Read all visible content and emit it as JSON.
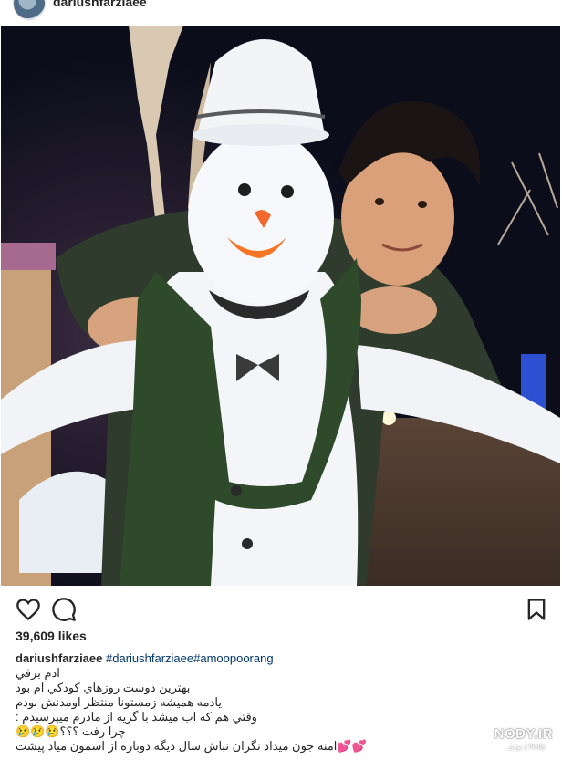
{
  "header": {
    "username": "dariushfarziaee",
    "avatar": "profile-avatar"
  },
  "post": {
    "image": "snowman-with-man-photo"
  },
  "actions": {
    "like_icon": "heart-icon",
    "comment_icon": "comment-bubble-icon",
    "save_icon": "bookmark-icon"
  },
  "likes": "39,609 likes",
  "caption": {
    "username": "dariushfarziaee",
    "hashtags": "#dariushfarziaee#amoopoorang",
    "lines": [
      "ادم برفي",
      "بهترين دوست روزهاي كودكي ام بود",
      "يادمه هميشه زمستونا منتظر اومدنش بودم",
      "وقتي هم كه اب ميشد با گريه از مادرم ميپرسيدم :",
      "چرا رفت ؟؟؟😢😢😢",
      "💕💕امنه جون ميداد نگران نباش سال ديگه دوباره از اسمون مياد پيشت"
    ]
  },
  "watermark": {
    "text": "NODY.IR",
    "subtext": "نودی | Nody"
  },
  "colors": {
    "link": "#00376b",
    "text": "#262626"
  }
}
